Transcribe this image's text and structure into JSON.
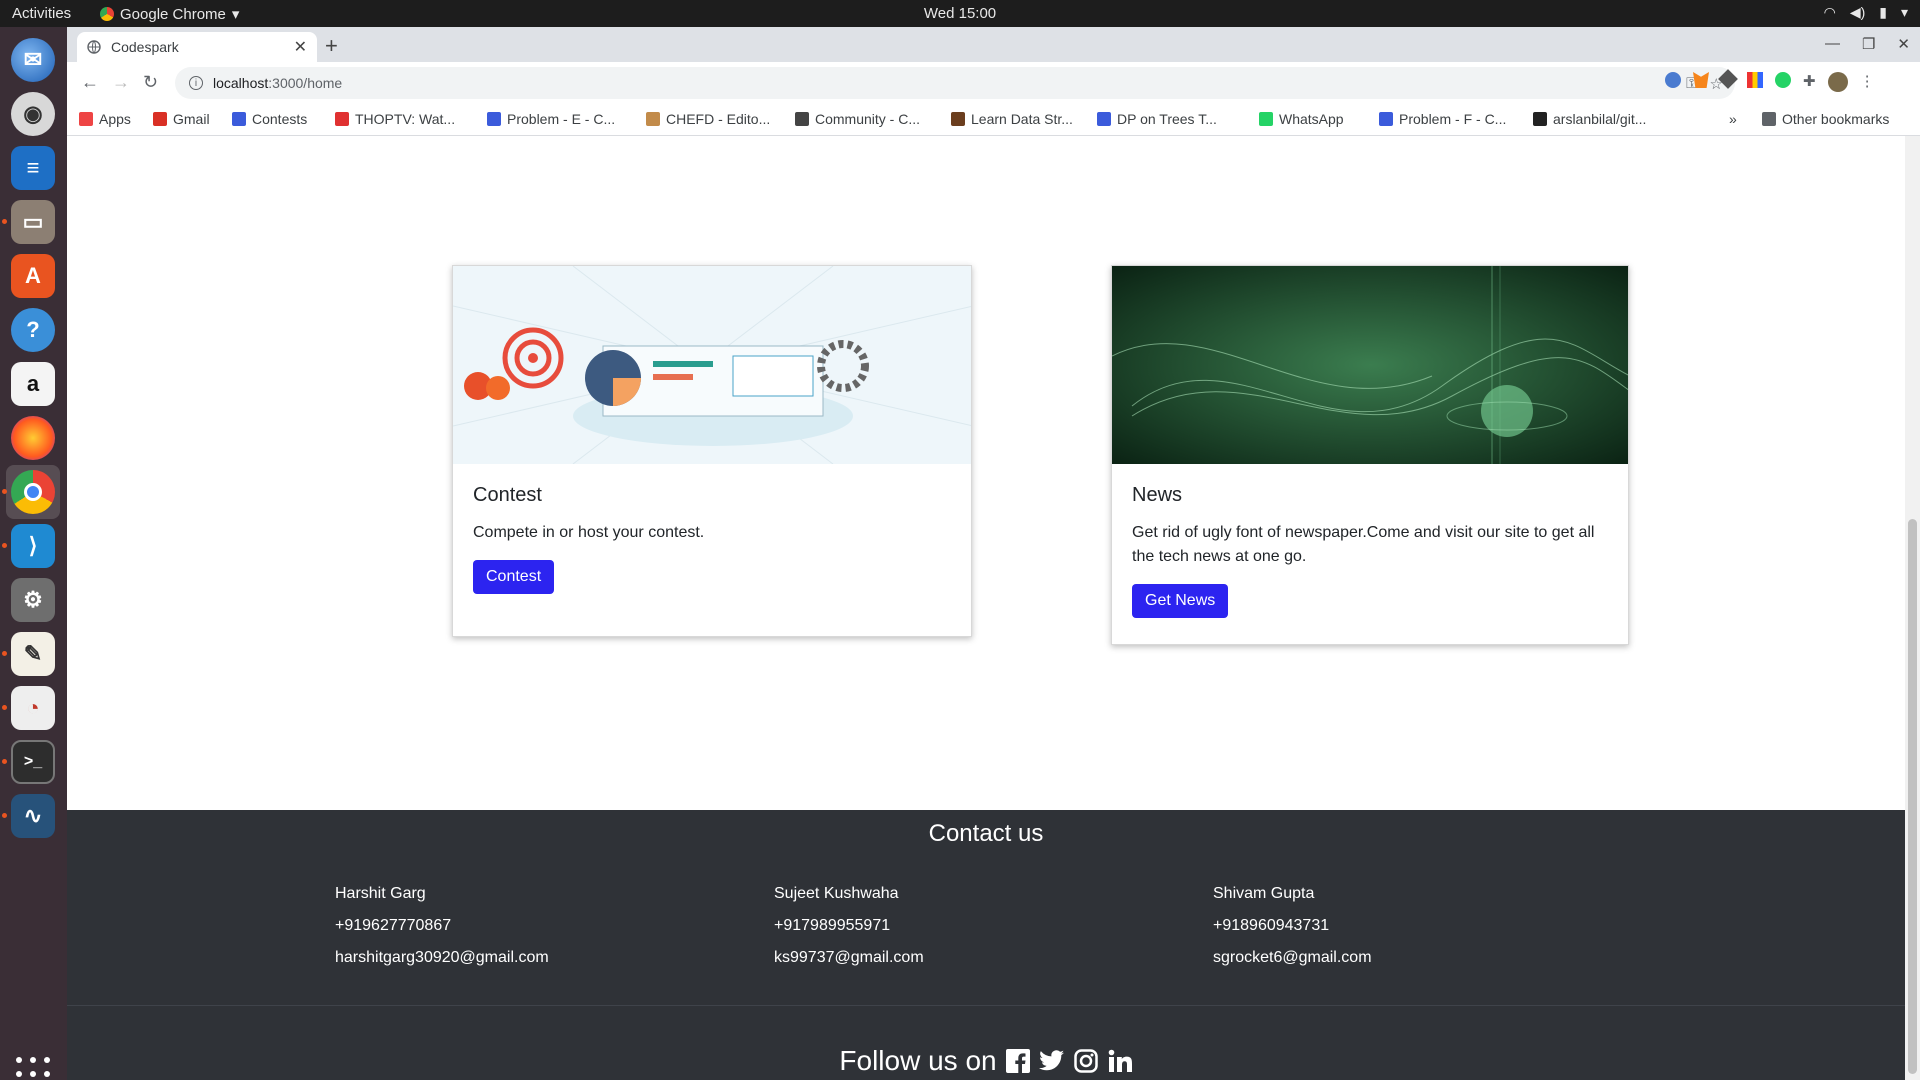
{
  "topbar": {
    "activities": "Activities",
    "app": "Google Chrome",
    "clock": "Wed 15:00"
  },
  "dock": {
    "items": [
      "thunderbird",
      "rhythmbox",
      "libreoffice-writer",
      "files",
      "software",
      "help",
      "amazon",
      "firefox",
      "chrome",
      "vscode",
      "settings",
      "text-editor",
      "evince",
      "terminal",
      "mysql-workbench"
    ]
  },
  "browser": {
    "tab_title": "Codespark",
    "url_host": "localhost",
    "url_path": ":3000/home",
    "bookmarks": [
      {
        "label": "Apps",
        "color": "#e44"
      },
      {
        "label": "Gmail",
        "color": "#d93025"
      },
      {
        "label": "Contests",
        "color": "#3b5bdb"
      },
      {
        "label": "THOPTV: Wat...",
        "color": "#e03131"
      },
      {
        "label": "Problem - E - C...",
        "color": "#3b5bdb"
      },
      {
        "label": "CHEFD - Edito...",
        "color": "#c28b4a"
      },
      {
        "label": "Community - C...",
        "color": "#444"
      },
      {
        "label": "Learn Data Str...",
        "color": "#6b3e1e"
      },
      {
        "label": "DP on Trees T...",
        "color": "#3b5bdb"
      },
      {
        "label": "WhatsApp",
        "color": "#25d366"
      },
      {
        "label": "Problem - F - C...",
        "color": "#3b5bdb"
      },
      {
        "label": "arslanbilal/git...",
        "color": "#222"
      }
    ],
    "more": "»",
    "other_bookmarks": "Other bookmarks"
  },
  "cards": [
    {
      "title": "Contest",
      "text": "Compete in or host your contest.",
      "button": "Contest"
    },
    {
      "title": "News",
      "text": "Get rid of ugly font of newspaper.Come and visit our site to get all the tech news at one go.",
      "button": "Get News"
    }
  ],
  "footer": {
    "heading": "Contact us",
    "contacts": [
      {
        "name": "Harshit Garg",
        "phone": "+919627770867",
        "email": "harshitgarg30920@gmail.com"
      },
      {
        "name": "Sujeet Kushwaha",
        "phone": "+917989955971",
        "email": "ks99737@gmail.com"
      },
      {
        "name": "Shivam Gupta",
        "phone": "+918960943731",
        "email": "sgrocket6@gmail.com"
      }
    ],
    "follow": "Follow us on"
  },
  "colors": {
    "primary_button": "#2c24f0",
    "footer_bg": "#2f3237"
  }
}
